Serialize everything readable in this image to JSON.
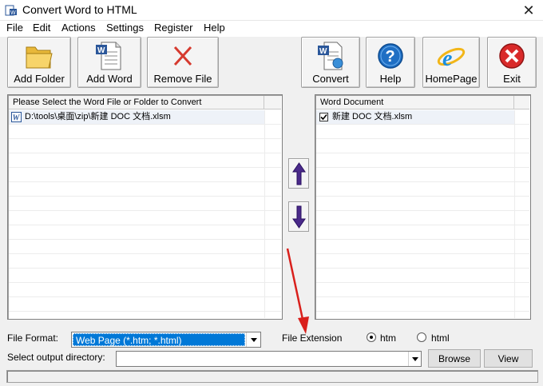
{
  "window": {
    "title": "Convert Word to HTML",
    "close_glyph": "✕"
  },
  "menu": {
    "items": [
      "File",
      "Edit",
      "Actions",
      "Settings",
      "Register",
      "Help"
    ]
  },
  "toolbar": {
    "add_folder": "Add Folder",
    "add_word": "Add Word",
    "remove_file": "Remove File",
    "convert": "Convert",
    "help": "Help",
    "homepage": "HomePage",
    "exit": "Exit"
  },
  "source_list": {
    "header": "Please Select the Word File or Folder to Convert",
    "rows": [
      "D:\\tools\\桌面\\zip\\新建 DOC 文档.xlsm"
    ]
  },
  "target_list": {
    "header": "Word Document",
    "rows": [
      {
        "label": "新建 DOC 文档.xlsm",
        "checked": true
      }
    ]
  },
  "options": {
    "file_format_label": "File Format:",
    "file_format_value": "Web Page (*.htm; *.html)",
    "file_extension_label": "File Extension",
    "ext_htm": "htm",
    "ext_html": "html",
    "selected_ext": "htm",
    "output_dir_label": "Select  output directory:",
    "output_dir_value": "",
    "browse": "Browse",
    "view": "View"
  },
  "colors": {
    "accent_selection": "#0078d7",
    "annotation_arrow": "#d9201c"
  }
}
